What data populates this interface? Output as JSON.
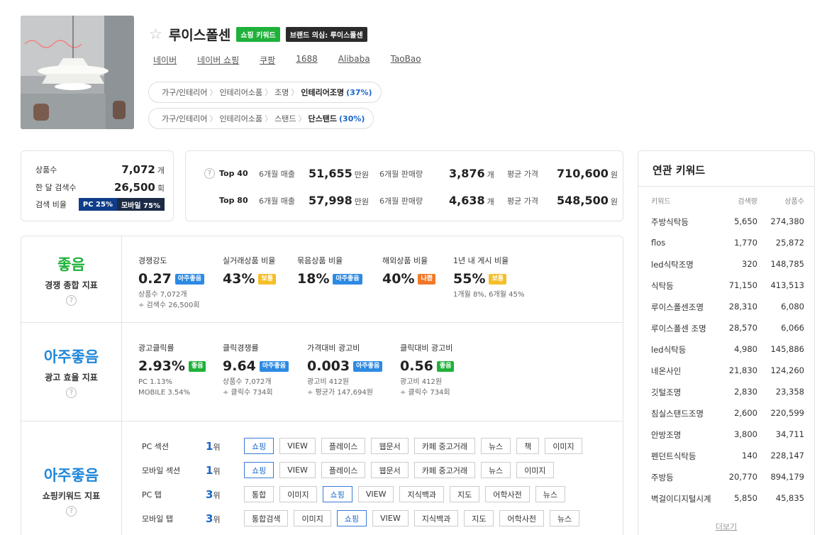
{
  "header": {
    "keyword": "루이스폴센",
    "badge_shopping": "쇼핑 키워드",
    "badge_brand": "브랜드 의심: 루이스폴센",
    "links": [
      "네이버",
      "네이버 쇼핑",
      "쿠팡",
      "1688",
      "Alibaba",
      "TaoBao"
    ],
    "categories": [
      {
        "path": [
          "가구/인테리어",
          "인테리어소품",
          "조명"
        ],
        "leaf": "인테리어조명",
        "pct": "(37%)"
      },
      {
        "path": [
          "가구/인테리어",
          "인테리어소품",
          "스탠드"
        ],
        "leaf": "단스탠드",
        "pct": "(30%)"
      }
    ]
  },
  "stats": {
    "product_count_label": "상품수",
    "product_count": "7,072",
    "product_unit": "개",
    "monthly_search_label": "한 달 검색수",
    "monthly_search": "26,500",
    "search_unit": "회",
    "ratio_label": "검색 비율",
    "pc_ratio": "PC 25%",
    "mobile_ratio": "모바일 75%",
    "pc_fraction": 0.25
  },
  "top": {
    "rows": [
      {
        "label": "Top 40",
        "sales_label": "6개월 매출",
        "sales": "51,655",
        "sales_unit": "만원",
        "qty_label": "6개월 판매량",
        "qty": "3,876",
        "qty_unit": "개",
        "price_label": "평균 가격",
        "price": "710,600",
        "price_unit": "원"
      },
      {
        "label": "Top 80",
        "sales_label": "6개월 매출",
        "sales": "57,998",
        "sales_unit": "만원",
        "qty_label": "6개월 판매량",
        "qty": "4,638",
        "qty_unit": "개",
        "price_label": "평균 가격",
        "price": "548,500",
        "price_unit": "원"
      }
    ],
    "help": "?"
  },
  "competition": {
    "grade": "좋음",
    "label": "경쟁 종합 지표",
    "help": "?",
    "metrics": [
      {
        "label": "경쟁강도",
        "value": "0.27",
        "tag": "아주좋음",
        "sub1": "상품수 7,072개",
        "sub2": "÷ 검색수 26,500회"
      },
      {
        "label": "실거래상품 비율",
        "value": "43%",
        "tag": "보통"
      },
      {
        "label": "묶음상품 비율",
        "value": "18%",
        "tag": "아주좋음"
      },
      {
        "label": "해외상품 비율",
        "value": "40%",
        "tag": "나쁨"
      },
      {
        "label": "1년 내 게시 비율",
        "value": "55%",
        "tag": "보통",
        "sub1": "1개월 8%, 6개월 45%"
      }
    ]
  },
  "ad": {
    "grade": "아주좋음",
    "label": "광고 효율 지표",
    "help": "?",
    "metrics": [
      {
        "label": "광고클릭률",
        "value": "2.93%",
        "tag": "좋음",
        "sub1": "PC 1.13%",
        "sub2": "MOBILE 3.54%"
      },
      {
        "label": "클릭경쟁률",
        "value": "9.64",
        "tag": "아주좋음",
        "sub1": "상품수 7,072개",
        "sub2": "÷ 클릭수 734회"
      },
      {
        "label": "가격대비 광고비",
        "value": "0.003",
        "tag": "아주좋음",
        "sub1": "광고비 412원",
        "sub2": "÷ 평균가 147,694원"
      },
      {
        "label": "클릭대비 광고비",
        "value": "0.56",
        "tag": "좋음",
        "sub1": "광고비 412원",
        "sub2": "÷ 클릭수 734회"
      }
    ]
  },
  "shopping": {
    "grade": "아주좋음",
    "label": "쇼핑키워드 지표",
    "help": "?",
    "rank_unit": "위",
    "rows": [
      {
        "name": "PC 섹션",
        "rank": "1",
        "chips": [
          "쇼핑",
          "VIEW",
          "플레이스",
          "웹문서",
          "카페 중고거래",
          "뉴스",
          "책",
          "이미지"
        ],
        "active": 0
      },
      {
        "name": "모바일 섹션",
        "rank": "1",
        "chips": [
          "쇼핑",
          "VIEW",
          "플레이스",
          "웹문서",
          "카페 중고거래",
          "뉴스",
          "이미지"
        ],
        "active": 0
      },
      {
        "name": "PC 탭",
        "rank": "3",
        "chips": [
          "통합",
          "이미지",
          "쇼핑",
          "VIEW",
          "지식백과",
          "지도",
          "어학사전",
          "뉴스"
        ],
        "active": 2
      },
      {
        "name": "모바일 탭",
        "rank": "3",
        "chips": [
          "통합검색",
          "이미지",
          "쇼핑",
          "VIEW",
          "지식백과",
          "지도",
          "어학사전",
          "뉴스"
        ],
        "active": 2
      }
    ]
  },
  "related": {
    "title": "연관 키워드",
    "headers": [
      "키워드",
      "검색량",
      "상품수"
    ],
    "rows": [
      [
        "주방식탁등",
        "5,650",
        "274,380"
      ],
      [
        "flos",
        "1,770",
        "25,872"
      ],
      [
        "led식탁조명",
        "320",
        "148,785"
      ],
      [
        "식탁등",
        "71,150",
        "413,513"
      ],
      [
        "루이스폴센조명",
        "28,310",
        "6,080"
      ],
      [
        "루이스폴센 조명",
        "28,570",
        "6,066"
      ],
      [
        "led식탁등",
        "4,980",
        "145,886"
      ],
      [
        "네온사인",
        "21,830",
        "124,260"
      ],
      [
        "깃털조명",
        "2,830",
        "23,358"
      ],
      [
        "침실스탠드조명",
        "2,600",
        "220,599"
      ],
      [
        "안방조명",
        "3,800",
        "34,711"
      ],
      [
        "펜던트식탁등",
        "140",
        "228,147"
      ],
      [
        "주방등",
        "20,770",
        "894,179"
      ],
      [
        "벽걸이디지털시계",
        "5,850",
        "45,835"
      ]
    ],
    "more": "더보기"
  },
  "colors": {
    "green": "#1fb13a",
    "blue_grade": "#1e86d9",
    "tag_blue": "#2d8ae3",
    "tag_orange": "#f07a2a",
    "tag_yellow": "#f5bf2a"
  }
}
